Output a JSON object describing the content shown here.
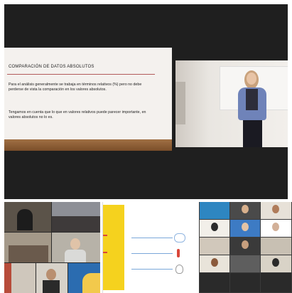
{
  "slide": {
    "title": "COMPARACIÓN DE DATOS ABSOLUTOS",
    "paragraph1": "Para el análisis generalmente se trabaja en términos relativos (%) pero no debe perderse de vista la comparación en los valores absolutos.",
    "paragraph2": "Tengamos en cuenta que lo que en valores relativos puede parecer importante, en valores absolutos no lo es."
  },
  "gallery_right": {
    "label_a": "",
    "label_b": ""
  },
  "colors": {
    "meeting_bg": "#1f1f1f",
    "slide_accent": "#b35a5a",
    "diagram_yellow": "#f5d21e"
  }
}
